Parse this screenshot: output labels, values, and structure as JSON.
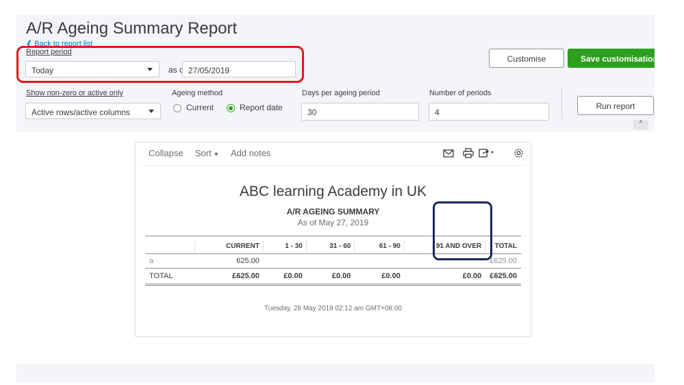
{
  "header": {
    "title": "A/R Ageing Summary Report",
    "back_link": "Back to report list"
  },
  "filters": {
    "report_period_label": "Report period",
    "report_period_value": "Today",
    "as_of_label": "as of",
    "as_of_date": "27/05/2019",
    "show_label": "Show non-zero or active only",
    "show_value": "Active rows/active columns",
    "ageing_method_label": "Ageing method",
    "ageing_options": [
      "Current",
      "Report date"
    ],
    "ageing_selected": "Report date",
    "days_label": "Days per ageing period",
    "days_value": "30",
    "periods_label": "Number of periods",
    "periods_value": "4"
  },
  "actions": {
    "customise": "Customise",
    "save_customisation": "Save customisation",
    "run_report": "Run report"
  },
  "report_toolbar": {
    "collapse": "Collapse",
    "sort": "Sort",
    "add_notes": "Add notes",
    "icons": [
      "email-icon",
      "print-icon",
      "export-icon",
      "settings-icon"
    ]
  },
  "report": {
    "company": "ABC learning Academy in UK",
    "title": "A/R AGEING SUMMARY",
    "as_of": "As of May 27, 2019",
    "columns": [
      "",
      "CURRENT",
      "1 - 30",
      "31 - 60",
      "61 - 90",
      "91 AND OVER",
      "TOTAL"
    ],
    "rows": [
      [
        "a",
        "625.00",
        "",
        "",
        "",
        "",
        "£625.00"
      ]
    ],
    "total_row": [
      "TOTAL",
      "£625.00",
      "£0.00",
      "£0.00",
      "£0.00",
      "£0.00",
      "£625.00"
    ],
    "footer": "Tuesday, 28 May 2019  02:12 am GMT+08:00"
  },
  "colors": {
    "accent_green": "#2ca01c",
    "link_blue": "#0077c5",
    "highlight_red": "#e8141c",
    "highlight_navy": "#15285e"
  }
}
